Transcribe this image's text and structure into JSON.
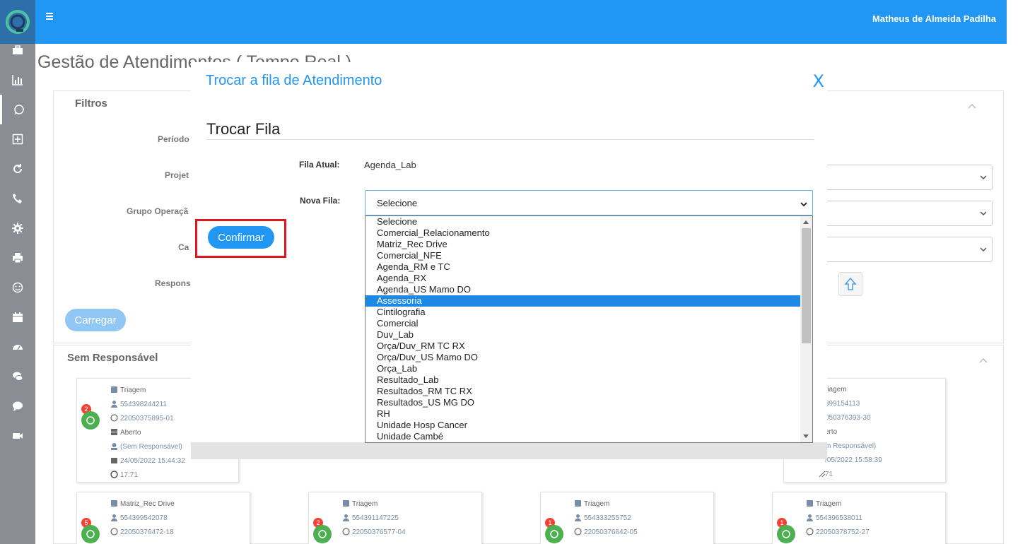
{
  "topbar": {
    "user_name": "Matheus de Almeida Padilha"
  },
  "page": {
    "title": "Gestão de Atendimentos ( Tempo Real )",
    "filters": {
      "title": "Filtros",
      "labels": [
        "Período",
        "Projet",
        "Grupo Operaçã",
        "Ca",
        "Respons"
      ],
      "load_button": "Carregar"
    },
    "unassigned": {
      "title": "Sem Responsável"
    },
    "cards": [
      {
        "badge": "2",
        "lines": [
          "Triagem",
          "554398244211",
          "22050375895-01",
          "Aberto",
          "(Sem Responsável)",
          "24/05/2022 15:44:32",
          "17:71"
        ]
      },
      {
        "badge": "",
        "lines": [
          "riagem",
          "399154113",
          "050376393-30",
          "erto",
          "m Responsável)",
          "/05/2022 15:58:39",
          "71"
        ]
      },
      {
        "badge": "5",
        "lines": [
          "Matriz_Rec Drive",
          "554399542078",
          "22050376472-18"
        ]
      },
      {
        "badge": "2",
        "lines": [
          "Triagem",
          "554391147225",
          "22050376577-04"
        ]
      },
      {
        "badge": "1",
        "lines": [
          "Triagem",
          "554333255752",
          "22050376642-05"
        ]
      },
      {
        "badge": "1",
        "lines": [
          "Triagem",
          "554396538011",
          "22050378752-27"
        ]
      }
    ]
  },
  "modal": {
    "title": "Trocar a fila de Atendimento",
    "close_label": "X",
    "section_title": "Trocar Fila",
    "current_label": "Fila Atual:",
    "current_value": "Agenda_Lab",
    "new_label": "Nova Fila:",
    "select_value": "Selecione",
    "confirm_label": "Confirmar",
    "options": [
      "Selecione",
      "Comercial_Relacionamento",
      "Matriz_Rec Drive",
      "Comercial_NFE",
      "Agenda_RM e TC",
      "Agenda_RX",
      "Agenda_US Mamo DO",
      "Assessoria",
      "Cintilografia",
      "Comercial",
      "Duv_Lab",
      "Orça/Duv_RM TC RX",
      "Orça/Duv_US Mamo DO",
      "Orça_Lab",
      "Resultado_Lab",
      "Resultados_RM TC RX",
      "Resultados_US MG DO",
      "RH",
      "Unidade Hosp Cancer",
      "Unidade Cambé"
    ],
    "highlighted_option": "Assessoria"
  },
  "colors": {
    "primary": "#2196f3",
    "sidebar": "#8a8d93",
    "highlight": "#e0161f",
    "whatsapp": "#4caf50"
  }
}
